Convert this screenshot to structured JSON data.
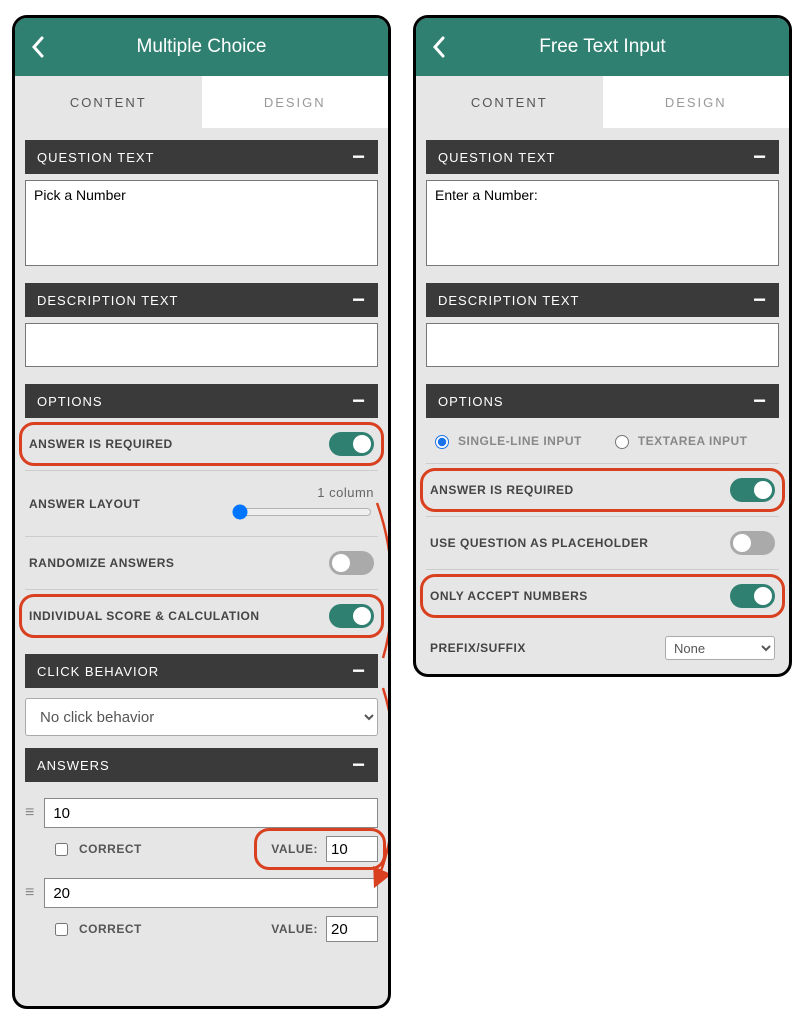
{
  "left_panel": {
    "title": "Multiple Choice",
    "tabs": {
      "content": "CONTENT",
      "design": "DESIGN"
    },
    "sections": {
      "question_text": "QUESTION TEXT",
      "description_text": "DESCRIPTION TEXT",
      "options": "OPTIONS",
      "click_behavior": "CLICK BEHAVIOR",
      "answers": "ANSWERS"
    },
    "question_value": "Pick a Number",
    "description_value": "",
    "options": {
      "answer_required": {
        "label": "ANSWER IS REQUIRED",
        "on": true
      },
      "answer_layout": {
        "label": "ANSWER LAYOUT",
        "value_text": "1 column"
      },
      "randomize": {
        "label": "RANDOMIZE ANSWERS",
        "on": false
      },
      "individual_score": {
        "label": "INDIVIDUAL SCORE & CALCULATION",
        "on": true
      }
    },
    "click_behavior_value": "No click behavior",
    "labels": {
      "correct": "CORRECT",
      "value": "VALUE:"
    },
    "answers": [
      {
        "text": "10",
        "correct": false,
        "value": 10
      },
      {
        "text": "20",
        "correct": false,
        "value": 20
      }
    ]
  },
  "right_panel": {
    "title": "Free Text Input",
    "tabs": {
      "content": "CONTENT",
      "design": "DESIGN"
    },
    "sections": {
      "question_text": "QUESTION TEXT",
      "description_text": "DESCRIPTION TEXT",
      "options": "OPTIONS"
    },
    "question_value": "Enter a Number:",
    "description_value": "",
    "input_type": {
      "single": "SINGLE-LINE INPUT",
      "textarea": "TEXTAREA INPUT",
      "selected": "single"
    },
    "options": {
      "answer_required": {
        "label": "ANSWER IS REQUIRED",
        "on": true
      },
      "placeholder": {
        "label": "USE QUESTION AS PLACEHOLDER",
        "on": false
      },
      "only_numbers": {
        "label": "ONLY ACCEPT NUMBERS",
        "on": true
      }
    },
    "prefix_suffix": {
      "label": "PREFIX/SUFFIX",
      "value": "None"
    }
  }
}
